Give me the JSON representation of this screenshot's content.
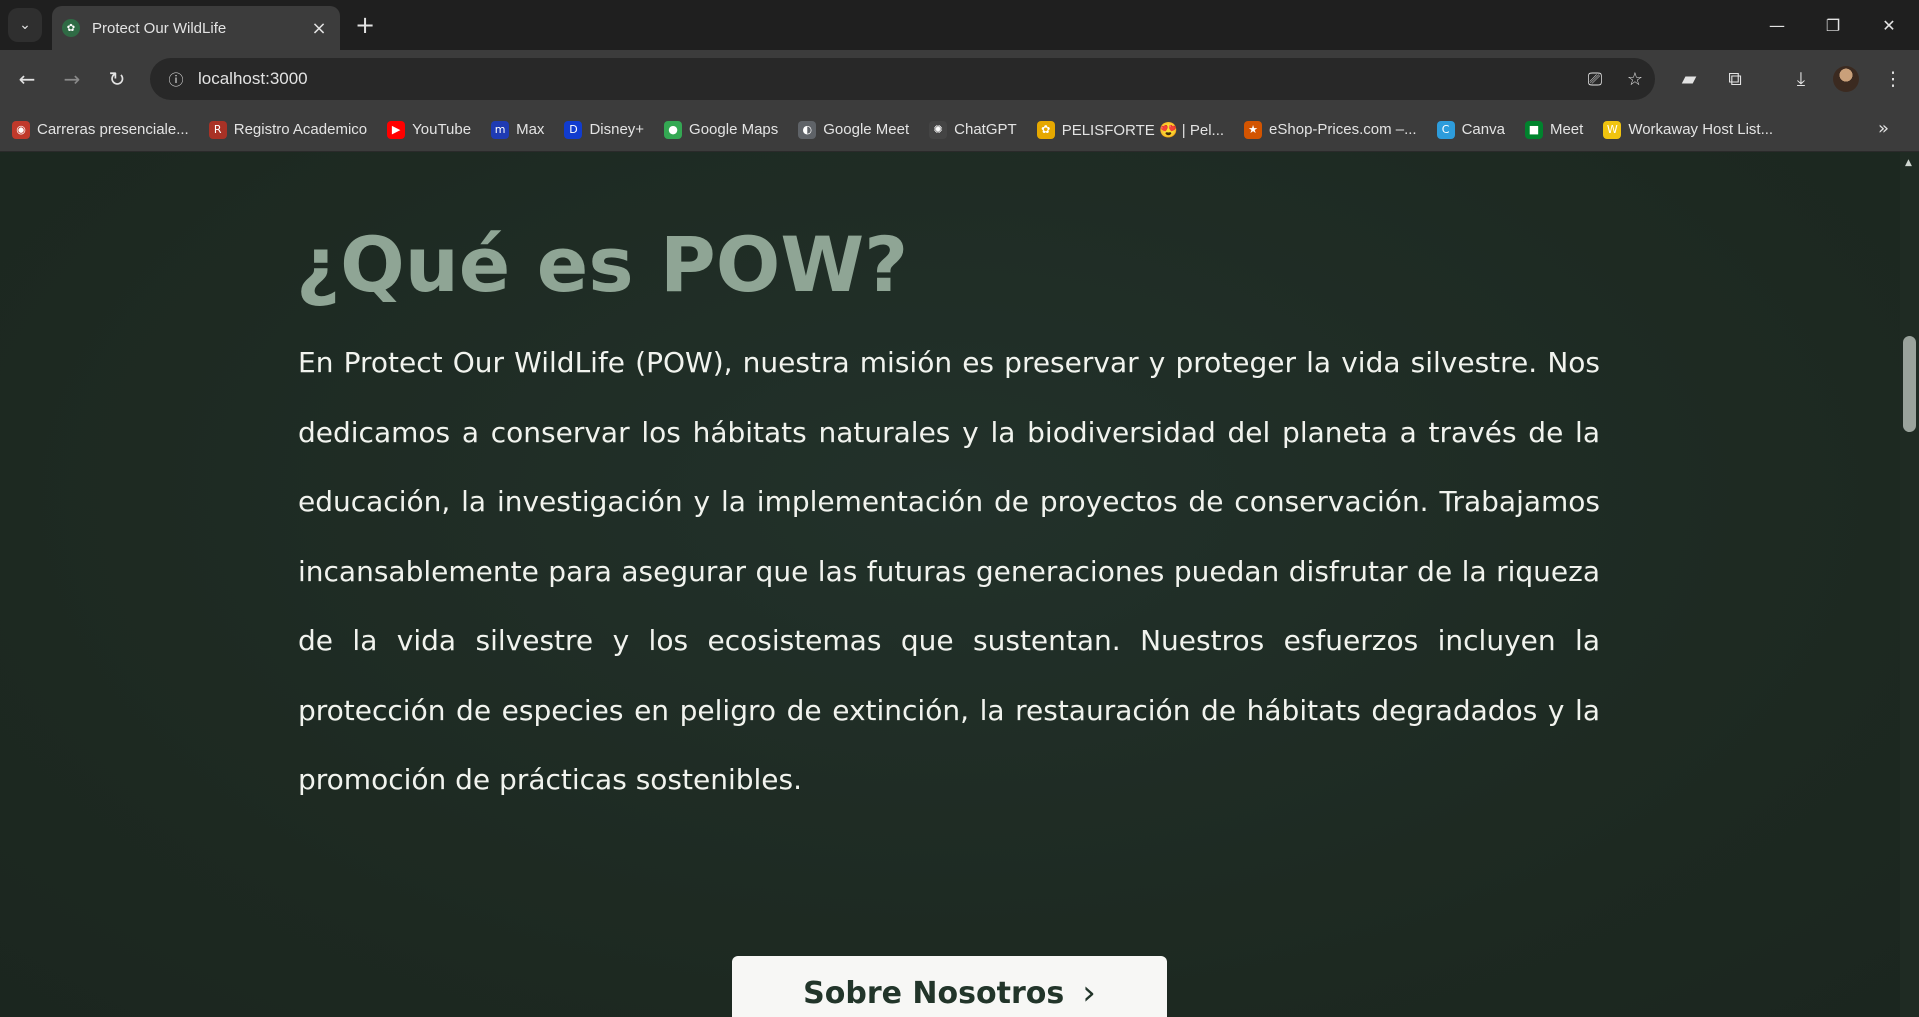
{
  "browser": {
    "tab_title": "Protect Our WildLife",
    "new_tab": "+",
    "close_tab": "×",
    "url": "localhost:3000",
    "window_controls": {
      "minimize": "—",
      "restore": "❐",
      "close": "✕"
    }
  },
  "bookmarks": [
    {
      "label": "Carreras presenciale...",
      "icon": "uni-icon",
      "color": "#c0392b",
      "glyph": "◉"
    },
    {
      "label": "Registro Academico",
      "icon": "registro-icon",
      "color": "#a93226",
      "glyph": "R"
    },
    {
      "label": "YouTube",
      "icon": "youtube-icon",
      "color": "#ff0000",
      "glyph": "▶"
    },
    {
      "label": "Max",
      "icon": "max-icon",
      "color": "#1f3bb3",
      "glyph": "m"
    },
    {
      "label": "Disney+",
      "icon": "disney-icon",
      "color": "#113ccf",
      "glyph": "D"
    },
    {
      "label": "Google Maps",
      "icon": "maps-icon",
      "color": "#34a853",
      "glyph": "●"
    },
    {
      "label": "Google Meet",
      "icon": "meet-icon",
      "color": "#5f6368",
      "glyph": "◐"
    },
    {
      "label": "ChatGPT",
      "icon": "chatgpt-icon",
      "color": "#444444",
      "glyph": "✺"
    },
    {
      "label": "PELISFORTE 😍 | Pel...",
      "icon": "pelisforte-icon",
      "color": "#e6a800",
      "glyph": "✿"
    },
    {
      "label": "eShop-Prices.com –...",
      "icon": "eshop-icon",
      "color": "#d35400",
      "glyph": "★"
    },
    {
      "label": "Canva",
      "icon": "canva-icon",
      "color": "#2d9cdb",
      "glyph": "C"
    },
    {
      "label": "Meet",
      "icon": "meet2-icon",
      "color": "#00832d",
      "glyph": "■"
    },
    {
      "label": "Workaway Host List...",
      "icon": "workaway-icon",
      "color": "#f1c40f",
      "glyph": "W"
    }
  ],
  "page": {
    "title": "¿Qué es POW?",
    "body": "En Protect Our WildLife (POW), nuestra misión es preservar y proteger la vida silvestre. Nos dedicamos a conservar los hábitats naturales y la biodiversidad del planeta a través de la educación, la investigación y la implementación de proyectos de conservación. Trabajamos incansablemente para asegurar que las futuras generaciones puedan disfrutar de la riqueza de la vida silvestre y los ecosistemas que sustentan. Nuestros esfuerzos incluyen la protección de especies en peligro de extinción, la restauración de hábitats degradados y la promoción de prácticas sostenibles.",
    "about_button": "Sobre Nosotros",
    "about_chevron": "›"
  }
}
